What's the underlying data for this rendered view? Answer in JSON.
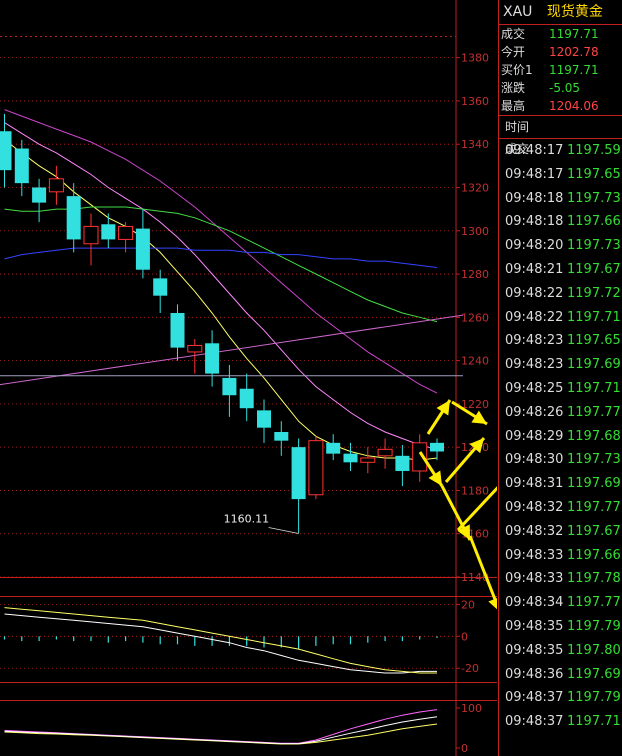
{
  "panel": {
    "symbol": "XAU",
    "name": "现货黄金",
    "quote": [
      {
        "label": "成交",
        "value": "1197.71",
        "color": "green"
      },
      {
        "label": "今开",
        "value": "1202.78",
        "color": "red"
      },
      {
        "label": "买价1",
        "value": "1197.71",
        "color": "green"
      },
      {
        "label": "涨跌",
        "value": "-5.05",
        "color": "green"
      },
      {
        "label": "最高",
        "value": "1204.06",
        "color": "red"
      }
    ],
    "ticks_header": {
      "time": "时间",
      "price": "成交"
    },
    "ticks": [
      {
        "time": "09:48:17",
        "price": "1197.59"
      },
      {
        "time": "09:48:17",
        "price": "1197.65"
      },
      {
        "time": "09:48:18",
        "price": "1197.73"
      },
      {
        "time": "09:48:18",
        "price": "1197.66"
      },
      {
        "time": "09:48:20",
        "price": "1197.73"
      },
      {
        "time": "09:48:21",
        "price": "1197.67"
      },
      {
        "time": "09:48:22",
        "price": "1197.72"
      },
      {
        "time": "09:48:22",
        "price": "1197.71"
      },
      {
        "time": "09:48:23",
        "price": "1197.65"
      },
      {
        "time": "09:48:23",
        "price": "1197.69"
      },
      {
        "time": "09:48:25",
        "price": "1197.71"
      },
      {
        "time": "09:48:26",
        "price": "1197.77"
      },
      {
        "time": "09:48:29",
        "price": "1197.68"
      },
      {
        "time": "09:48:30",
        "price": "1197.73"
      },
      {
        "time": "09:48:31",
        "price": "1197.69"
      },
      {
        "time": "09:48:32",
        "price": "1197.77"
      },
      {
        "time": "09:48:32",
        "price": "1197.67"
      },
      {
        "time": "09:48:33",
        "price": "1197.66"
      },
      {
        "time": "09:48:33",
        "price": "1197.78"
      },
      {
        "time": "09:48:34",
        "price": "1197.77"
      },
      {
        "time": "09:48:35",
        "price": "1197.79"
      },
      {
        "time": "09:48:35",
        "price": "1197.80"
      },
      {
        "time": "09:48:36",
        "price": "1197.69"
      },
      {
        "time": "09:48:37",
        "price": "1197.79"
      },
      {
        "time": "09:48:37",
        "price": "1197.71"
      }
    ]
  },
  "colors": {
    "up": "#ff3333",
    "down": "#33e0e0",
    "grid": "#c02020",
    "text": "#c03030",
    "arrow": "#ffee00"
  },
  "chart_data": {
    "type": "candlestick",
    "ylim": [
      1140,
      1390
    ],
    "y_ticks": [
      1380,
      1360,
      1340,
      1320,
      1300,
      1280,
      1260,
      1240,
      1220,
      1200,
      1180,
      1160,
      1140
    ],
    "low_annotation": "1160.11",
    "candles": [
      {
        "o": 1346,
        "h": 1354,
        "l": 1320,
        "c": 1328
      },
      {
        "o": 1338,
        "h": 1342,
        "l": 1316,
        "c": 1322
      },
      {
        "o": 1320,
        "h": 1324,
        "l": 1304,
        "c": 1313
      },
      {
        "o": 1318,
        "h": 1330,
        "l": 1312,
        "c": 1324
      },
      {
        "o": 1316,
        "h": 1322,
        "l": 1290,
        "c": 1296
      },
      {
        "o": 1294,
        "h": 1308,
        "l": 1284,
        "c": 1302
      },
      {
        "o": 1303,
        "h": 1308,
        "l": 1292,
        "c": 1296
      },
      {
        "o": 1296,
        "h": 1304,
        "l": 1290,
        "c": 1302
      },
      {
        "o": 1301,
        "h": 1310,
        "l": 1278,
        "c": 1282
      },
      {
        "o": 1278,
        "h": 1282,
        "l": 1262,
        "c": 1270
      },
      {
        "o": 1262,
        "h": 1266,
        "l": 1240,
        "c": 1246
      },
      {
        "o": 1244,
        "h": 1250,
        "l": 1234,
        "c": 1247
      },
      {
        "o": 1248,
        "h": 1254,
        "l": 1228,
        "c": 1234
      },
      {
        "o": 1232,
        "h": 1238,
        "l": 1214,
        "c": 1224
      },
      {
        "o": 1227,
        "h": 1234,
        "l": 1212,
        "c": 1218
      },
      {
        "o": 1217,
        "h": 1222,
        "l": 1202,
        "c": 1209
      },
      {
        "o": 1207,
        "h": 1212,
        "l": 1196,
        "c": 1203
      },
      {
        "o": 1200,
        "h": 1204,
        "l": 1160.11,
        "c": 1176
      },
      {
        "o": 1178,
        "h": 1205,
        "l": 1176,
        "c": 1203
      },
      {
        "o": 1202,
        "h": 1206,
        "l": 1194,
        "c": 1197
      },
      {
        "o": 1197,
        "h": 1202,
        "l": 1189,
        "c": 1193
      },
      {
        "o": 1193,
        "h": 1200,
        "l": 1188,
        "c": 1195
      },
      {
        "o": 1196,
        "h": 1204,
        "l": 1190,
        "c": 1199
      },
      {
        "o": 1196,
        "h": 1201,
        "l": 1182,
        "c": 1189
      },
      {
        "o": 1189,
        "h": 1206,
        "l": 1184,
        "c": 1202
      },
      {
        "o": 1202,
        "h": 1204,
        "l": 1194,
        "c": 1198
      }
    ],
    "moving_averages": [
      {
        "color": "#ffff66",
        "values": [
          1342,
          1336,
          1330,
          1325,
          1318,
          1312,
          1306,
          1302,
          1297,
          1290,
          1281,
          1272,
          1262,
          1251,
          1241,
          1232,
          1222,
          1212,
          1205,
          1201,
          1198,
          1196,
          1195,
          1195,
          1194,
          1195
        ]
      },
      {
        "color": "#ff88ff",
        "values": [
          1350,
          1345,
          1340,
          1336,
          1331,
          1326,
          1320,
          1315,
          1310,
          1304,
          1297,
          1289,
          1280,
          1271,
          1262,
          1254,
          1245,
          1236,
          1228,
          1222,
          1216,
          1211,
          1207,
          1204,
          1201,
          1199
        ]
      },
      {
        "color": "#cc44cc",
        "values": [
          1356,
          1353,
          1350,
          1347,
          1344,
          1341,
          1337,
          1333,
          1328,
          1323,
          1317,
          1311,
          1304,
          1297,
          1290,
          1283,
          1276,
          1269,
          1262,
          1256,
          1250,
          1244,
          1239,
          1234,
          1229,
          1225
        ]
      },
      {
        "color": "#44dd44",
        "values": [
          1310,
          1309,
          1309,
          1310,
          1310,
          1311,
          1311,
          1311,
          1310,
          1309,
          1308,
          1306,
          1303,
          1300,
          1296,
          1292,
          1288,
          1284,
          1280,
          1276,
          1272,
          1268,
          1265,
          1262,
          1260,
          1258
        ]
      },
      {
        "color": "#3344ff",
        "values": [
          1287,
          1289,
          1290,
          1291,
          1292,
          1292,
          1292,
          1292,
          1292,
          1292,
          1292,
          1291,
          1291,
          1291,
          1290,
          1290,
          1289,
          1289,
          1288,
          1287,
          1287,
          1286,
          1286,
          1285,
          1284,
          1283
        ]
      }
    ],
    "trendlines": [
      {
        "color": "#cc66cc",
        "from": [
          -1,
          1228
        ],
        "to": [
          26.5,
          1261
        ]
      },
      {
        "color": "#a0a0c0",
        "from": [
          -1,
          1233
        ],
        "to": [
          26.5,
          1233
        ]
      }
    ],
    "macd": {
      "y_ticks": [
        20,
        0,
        -20
      ],
      "ylim": [
        -28,
        24
      ],
      "hist": [
        -2,
        -3,
        -3,
        -2,
        -3,
        -3,
        -4,
        -3,
        -4,
        -5,
        -5,
        -6,
        -6,
        -6,
        -6,
        -7,
        -7,
        -8,
        -6,
        -5,
        -5,
        -4,
        -3,
        -3,
        -2,
        -1
      ],
      "dif": [
        14,
        13,
        12,
        11,
        10,
        9,
        8,
        7,
        6,
        4,
        2,
        0,
        -2,
        -4,
        -7,
        -9,
        -12,
        -15,
        -17,
        -19,
        -21,
        -22,
        -23,
        -23,
        -22,
        -22
      ],
      "dea": [
        18,
        17,
        16,
        15,
        14,
        13,
        12,
        11,
        10,
        8,
        6,
        4,
        2,
        0,
        -2,
        -4,
        -6,
        -8,
        -11,
        -14,
        -17,
        -19,
        -21,
        -22,
        -23,
        -23
      ]
    },
    "oscillator": {
      "y_ticks": [
        100,
        0
      ],
      "ylim": [
        -5,
        115
      ],
      "lines": [
        {
          "color": "#ffff66",
          "values": [
            40,
            38,
            36,
            35,
            33,
            32,
            30,
            28,
            26,
            24,
            22,
            20,
            18,
            16,
            14,
            12,
            10,
            10,
            14,
            20,
            26,
            32,
            40,
            48,
            54,
            60
          ]
        },
        {
          "color": "#ff66ff",
          "values": [
            44,
            42,
            40,
            38,
            36,
            34,
            32,
            30,
            28,
            26,
            24,
            22,
            20,
            18,
            16,
            14,
            12,
            12,
            20,
            34,
            48,
            60,
            72,
            82,
            90,
            96
          ]
        },
        {
          "color": "#ffffff",
          "values": [
            42,
            40,
            38,
            37,
            35,
            33,
            31,
            29,
            27,
            25,
            23,
            21,
            19,
            17,
            15,
            13,
            11,
            11,
            17,
            27,
            37,
            46,
            56,
            65,
            72,
            78
          ]
        }
      ]
    }
  }
}
